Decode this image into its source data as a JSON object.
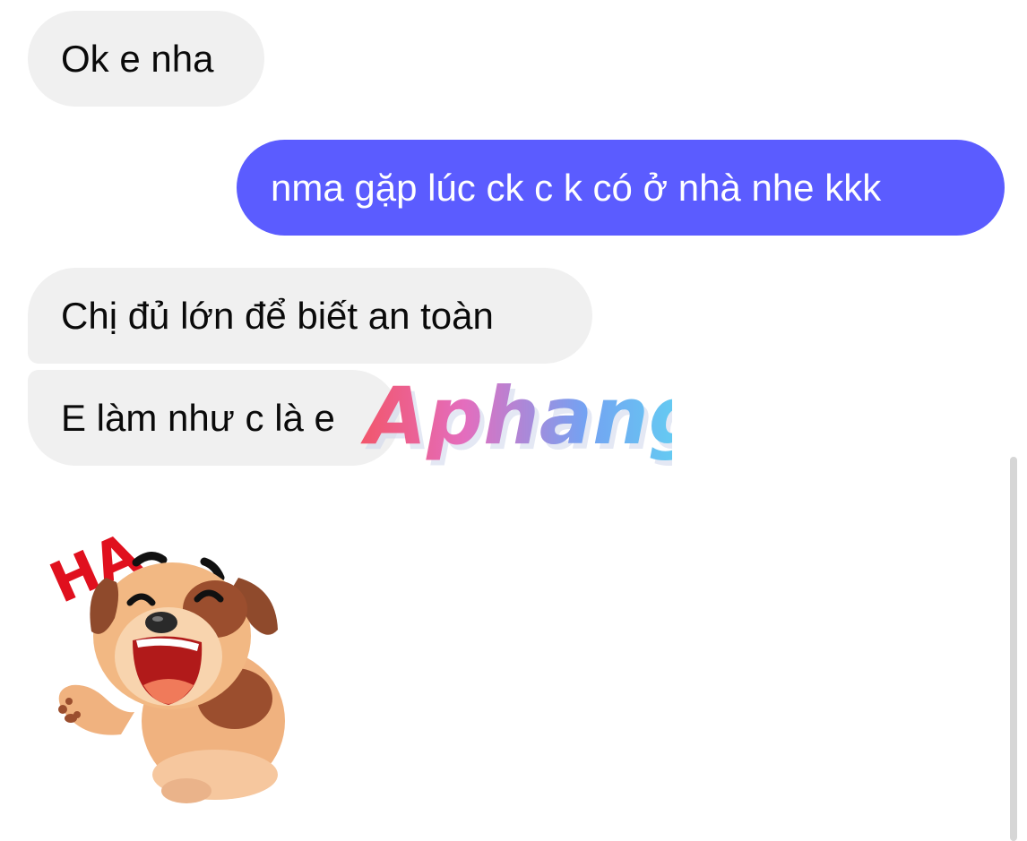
{
  "conversation": {
    "messages": [
      {
        "direction": "incoming",
        "text": "Ok e nha"
      },
      {
        "direction": "outgoing",
        "text": "nma gặp lúc ck c k có ở nhà nhe kkk"
      },
      {
        "direction": "incoming",
        "text": "Chị đủ lớn để biết an toàn"
      },
      {
        "direction": "incoming",
        "text": "E làm như c là e"
      }
    ],
    "sticker": {
      "caption": "HA",
      "icon": "laughing-dog-sticker"
    }
  },
  "watermark": {
    "text": "Aphang"
  },
  "colors": {
    "outgoing_bubble": "#5b5cff",
    "incoming_bubble": "#f0f0f0",
    "background": "#ffffff"
  }
}
